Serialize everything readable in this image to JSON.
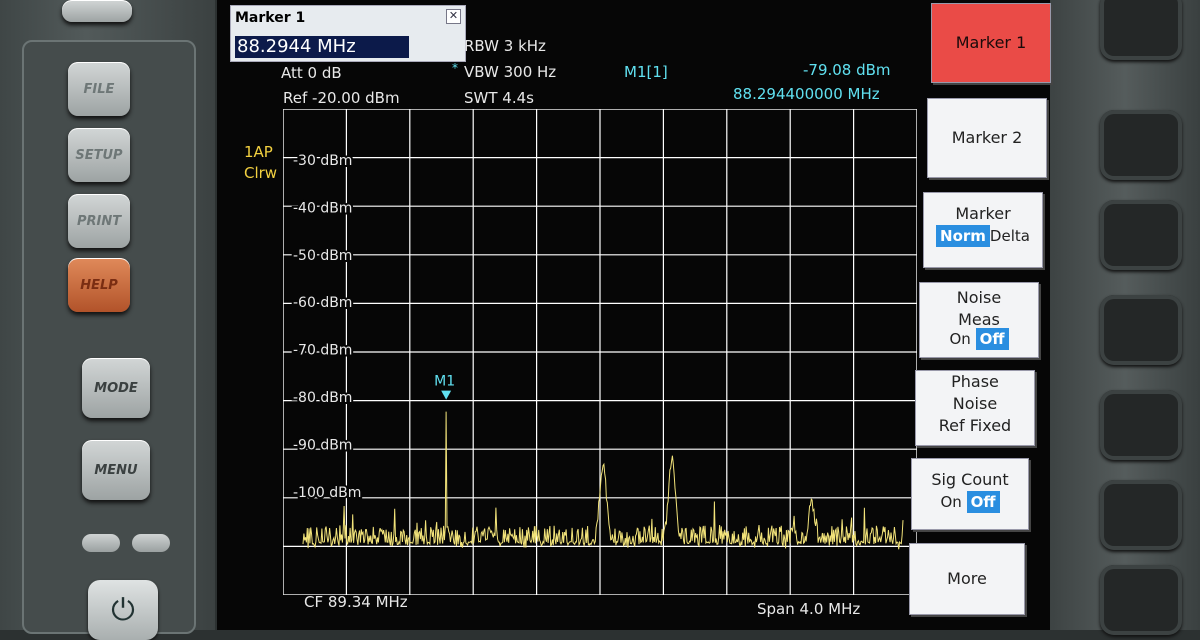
{
  "device": {
    "buttons": [
      "FILE",
      "SETUP",
      "PRINT",
      "HELP",
      "MODE",
      "MENU"
    ]
  },
  "marker_dialog": {
    "title": "Marker 1",
    "value": "88.2944 MHz"
  },
  "settings": {
    "att": "Att  0 dB",
    "ref": "Ref  -20.00 dBm",
    "rbw": "RBW 3 kHz",
    "vbw": "VBW 300 Hz",
    "vbw_flag": "*",
    "swt": "SWT 4.4s",
    "trace": "1AP",
    "detector": "Clrw",
    "marker_name": "M1[1]",
    "marker_level": "-79.08 dBm",
    "marker_freq": "88.294400000 MHz",
    "center_freq": "CF 89.34 MHz",
    "span": "Span 4.0 MHz"
  },
  "chart_data": {
    "type": "line",
    "title": "",
    "xlabel": "",
    "ylabel": "",
    "y_ticks": [
      "-30 dBm",
      "-40 dBm",
      "-50 dBm",
      "-60 dBm",
      "-70 dBm",
      "-80 dBm",
      "-90 dBm",
      "-100 dBm"
    ],
    "xlim": [
      87.34,
      91.34
    ],
    "ylim": [
      -110,
      -20
    ],
    "x_unit": "MHz",
    "y_unit": "dBm",
    "grid": true,
    "noise_floor_dbm": -105,
    "peaks": [
      {
        "x": 88.2944,
        "y": -79.08,
        "label": "M1"
      },
      {
        "x": 88.6,
        "y": -102
      },
      {
        "x": 89.34,
        "y": -90
      },
      {
        "x": 89.8,
        "y": -89
      },
      {
        "x": 90.73,
        "y": -97
      }
    ],
    "colors": {
      "trace": "#f2e37a",
      "grid": "#ffffff",
      "marker": "#60e0f0",
      "background": "#060606"
    }
  },
  "softkeys": [
    {
      "id": "marker1",
      "label": "Marker 1",
      "active": true
    },
    {
      "id": "marker2",
      "label": "Marker 2"
    },
    {
      "id": "marker-mode",
      "label": "Marker",
      "options": [
        "Norm",
        "Delta"
      ],
      "selected": "Norm"
    },
    {
      "id": "noise-meas",
      "label_lines": [
        "Noise",
        "Meas"
      ],
      "options": [
        "On",
        "Off"
      ],
      "selected": "Off"
    },
    {
      "id": "phase-noise",
      "label_lines": [
        "Phase",
        "Noise",
        "Ref Fixed"
      ]
    },
    {
      "id": "sig-count",
      "label": "Sig Count",
      "options": [
        "On",
        "Off"
      ],
      "selected": "Off"
    },
    {
      "id": "more",
      "label": "More"
    }
  ],
  "colors": {
    "accent": "#ea4b47",
    "selected": "#2a8ee0",
    "screen": "#060606"
  }
}
